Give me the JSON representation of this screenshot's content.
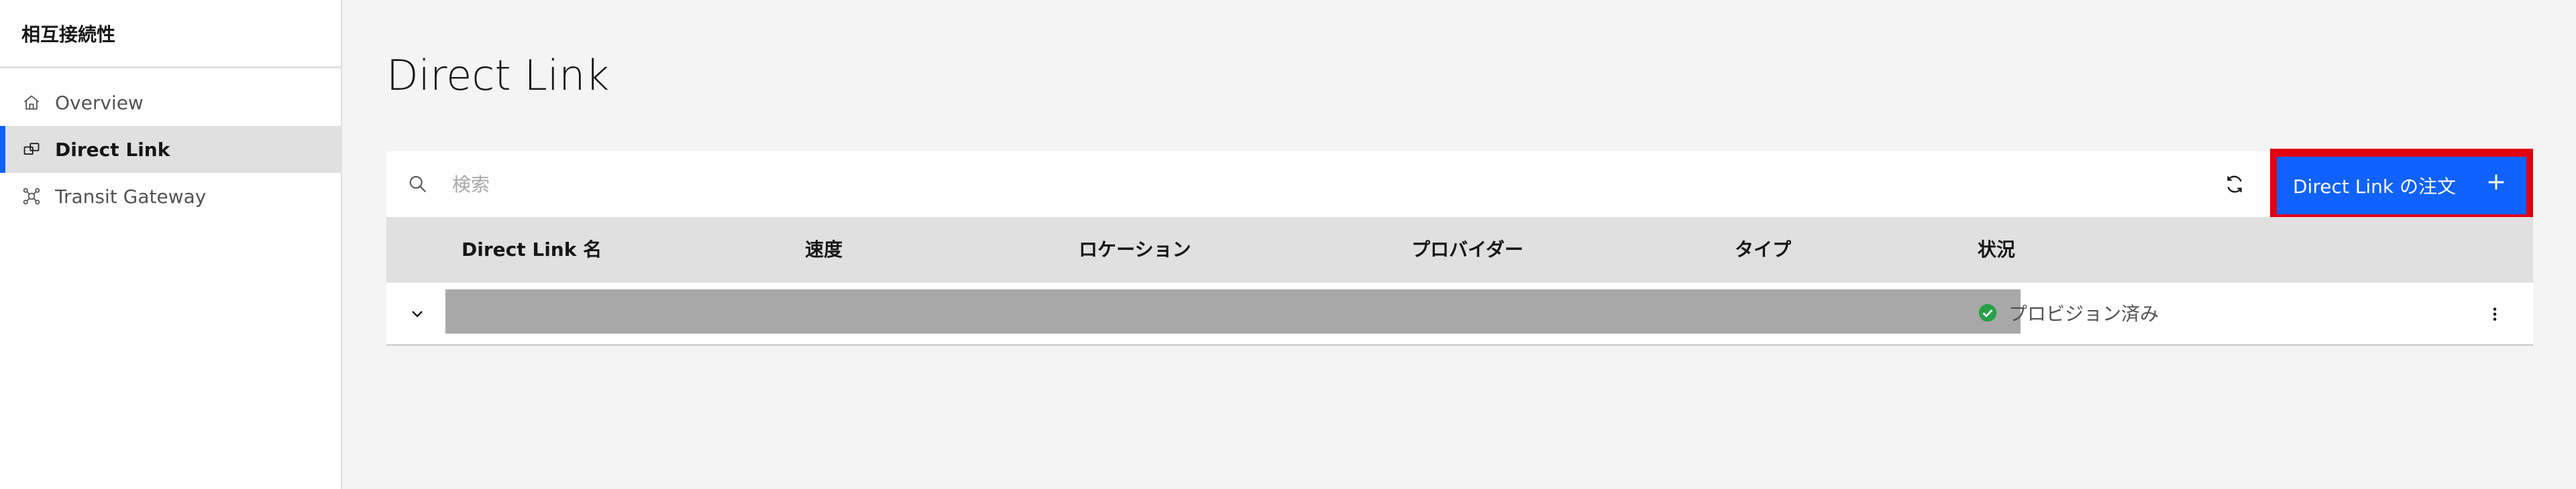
{
  "sidebar": {
    "title": "相互接続性",
    "items": [
      {
        "label": "Overview",
        "icon": "home-icon",
        "active": false
      },
      {
        "label": "Direct Link",
        "icon": "direct-link-icon",
        "active": true
      },
      {
        "label": "Transit Gateway",
        "icon": "transit-gateway-icon",
        "active": false
      }
    ]
  },
  "main": {
    "title": "Direct Link",
    "search": {
      "placeholder": "検索",
      "value": ""
    },
    "order_button": {
      "label": "Direct Link の注文",
      "icon": "+"
    },
    "table": {
      "headers": [
        "Direct Link 名",
        "速度",
        "ロケーション",
        "プロバイダー",
        "タイプ",
        "状況"
      ],
      "rows": [
        {
          "status": "プロビジョン済み",
          "redacted": true
        }
      ]
    }
  },
  "colors": {
    "accent": "#0f62fe",
    "highlight": "#e0000f",
    "success": "#24a148",
    "redacted": "#a8a8a8"
  }
}
